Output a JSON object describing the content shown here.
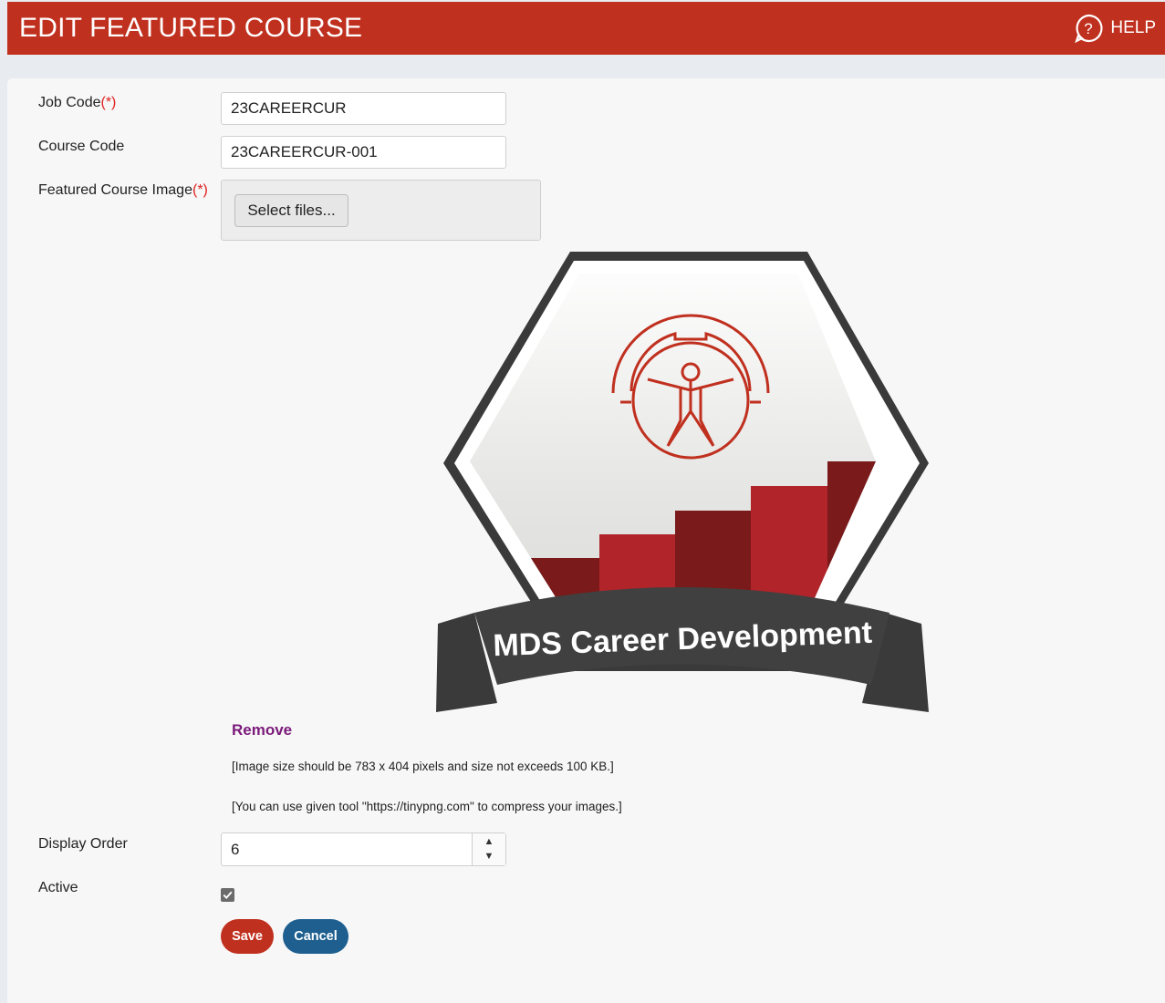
{
  "header": {
    "title": "EDIT FEATURED COURSE",
    "help_label": "HELP"
  },
  "form": {
    "job_code": {
      "label": "Job Code",
      "required_mark": "(*)",
      "value": "23CAREERCUR"
    },
    "course_code": {
      "label": "Course Code",
      "value": "23CAREERCUR-001"
    },
    "featured_image": {
      "label": "Featured Course Image",
      "required_mark": "(*)",
      "select_button": "Select files...",
      "banner_text": "MDS Career Development",
      "remove_label": "Remove",
      "note_size": "[Image size should be 783 x 404 pixels and size not exceeds 100 KB.]",
      "note_tool": "[You can use given tool \"https://tinypng.com\" to compress your images.]"
    },
    "display_order": {
      "label": "Display Order",
      "value": "6"
    },
    "active": {
      "label": "Active",
      "checked": true
    },
    "save_label": "Save",
    "cancel_label": "Cancel"
  },
  "colors": {
    "header": "#c0301f",
    "save": "#c0301f",
    "cancel": "#1e5f8f",
    "remove": "#7b1a7b"
  }
}
